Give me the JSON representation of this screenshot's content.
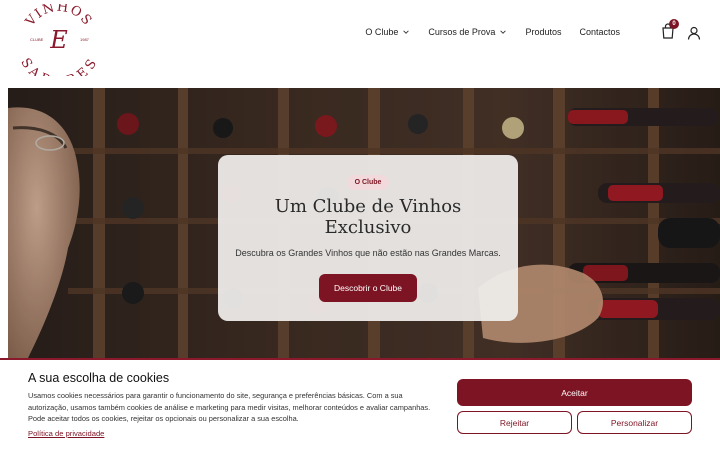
{
  "logo": {
    "top_text": "VINHOS",
    "letter": "E",
    "bottom_text": "SABORES",
    "left_small": "CLUBE",
    "right_small": "1987"
  },
  "nav": {
    "items": [
      {
        "label": "O Clube",
        "dropdown": true
      },
      {
        "label": "Cursos de Prova",
        "dropdown": true
      },
      {
        "label": "Produtos",
        "dropdown": false
      },
      {
        "label": "Contactos",
        "dropdown": false
      }
    ],
    "cart_count": "0"
  },
  "hero": {
    "pill": "O Clube",
    "title": "Um Clube de Vinhos Exclusivo",
    "subtitle": "Descubra os Grandes Vinhos que não estão nas Grandes Marcas.",
    "cta": "Descobrir o Clube"
  },
  "cookie": {
    "title": "A sua escolha de cookies",
    "text": "Usamos cookies necessários para garantir o funcionamento do site, segurança e preferências básicas. Com a sua autorização, usamos também cookies de análise e marketing para medir visitas, melhorar conteúdos e avaliar campanhas. Pode aceitar todos os cookies, rejeitar os opcionais ou personalizar a sua escolha.",
    "privacy_link": "Política de privacidade",
    "accept": "Aceitar",
    "reject": "Rejeitar",
    "customize": "Personalizar"
  },
  "colors": {
    "accent": "#7d1423",
    "pill_bg": "#f1d9dc"
  }
}
